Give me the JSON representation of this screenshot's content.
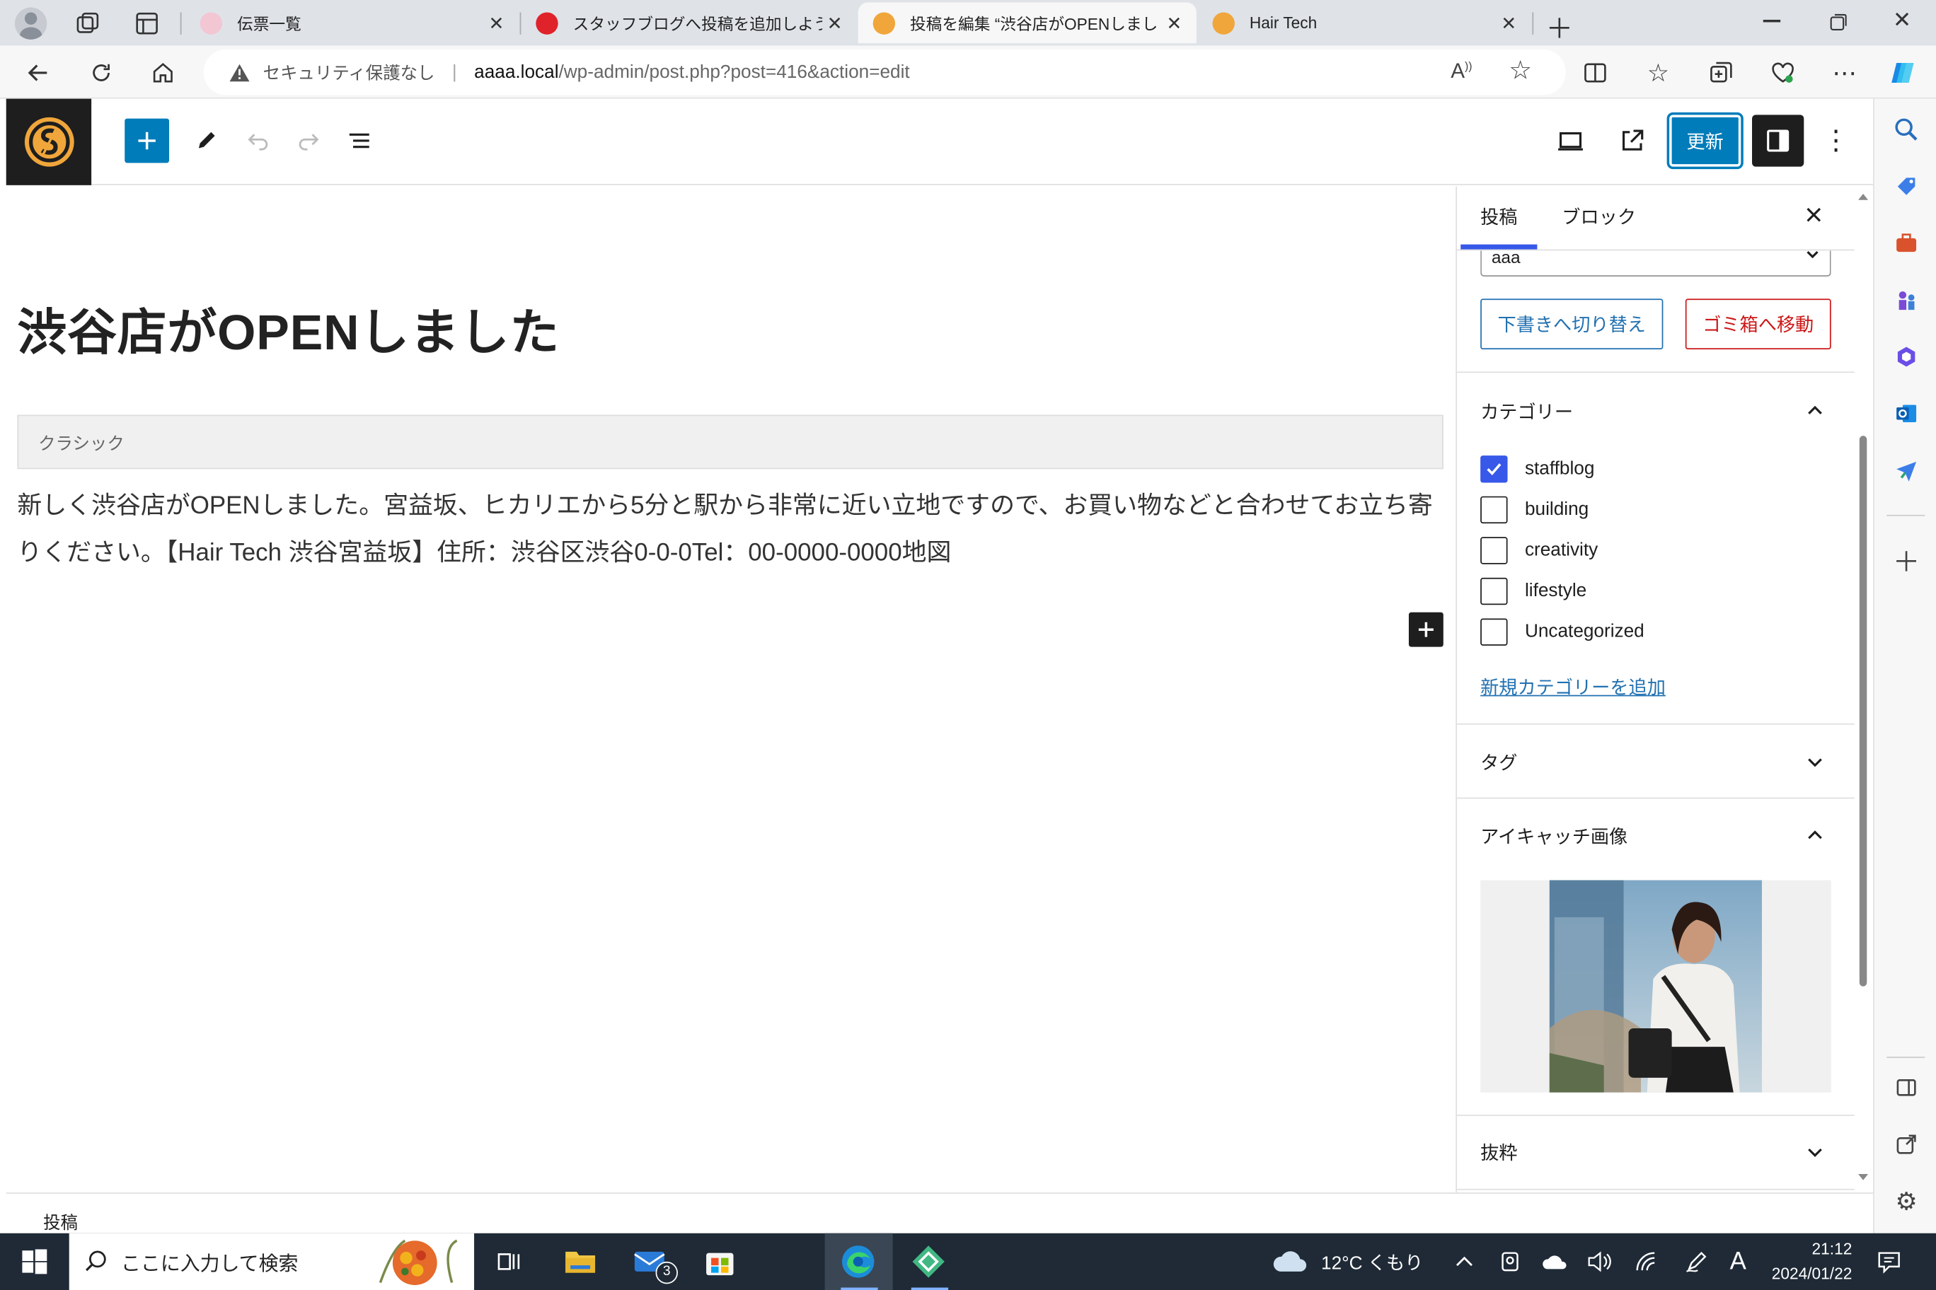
{
  "browser": {
    "tabs": [
      {
        "title": "伝票一覧",
        "active": false,
        "favicon_color": "#e8a0b8"
      },
      {
        "title": "スタッフブログへ投稿を追加しよう | ブ",
        "active": false,
        "favicon_color": "#e0222b"
      },
      {
        "title": "投稿を編集 “渋谷店がOPENしまし",
        "active": true,
        "favicon_color": "#f0a63a"
      },
      {
        "title": "Hair Tech",
        "active": false,
        "favicon_color": "#f0a63a"
      }
    ],
    "security_label": "セキュリティ保護なし",
    "url_host": "aaaa.local",
    "url_path": "/wp-admin/post.php?post=416&action=edit"
  },
  "toolbar": {
    "update_label": "更新"
  },
  "editor": {
    "post_title": "渋谷店がOPENしました",
    "classic_block_label": "クラシック",
    "body_text": "新しく渋谷店がOPENしました。宮益坂、ヒカリエから5分と駅から非常に近い立地ですので、お買い物などと合わせてお立ち寄りください。【Hair Tech 渋谷宮益坂】住所：渋谷区渋谷0-0-0Tel：00-0000-0000地図"
  },
  "sidebar": {
    "tab_post": "投稿",
    "tab_block": "ブロック",
    "select_value": "aaa",
    "switch_draft_label": "下書きへ切り替え",
    "trash_label": "ゴミ箱へ移動",
    "categories_title": "カテゴリー",
    "categories": [
      {
        "label": "staffblog",
        "checked": true
      },
      {
        "label": "building",
        "checked": false
      },
      {
        "label": "creativity",
        "checked": false
      },
      {
        "label": "lifestyle",
        "checked": false
      },
      {
        "label": "Uncategorized",
        "checked": false
      }
    ],
    "add_category_label": "新規カテゴリーを追加",
    "tags_title": "タグ",
    "featured_image_title": "アイキャッチ画像",
    "excerpt_title": "抜粋"
  },
  "status_bar": {
    "breadcrumb": "投稿"
  },
  "taskbar": {
    "search_placeholder": "ここに入力して検索",
    "weather": "12°C くもり",
    "mail_badge": "3",
    "time": "21:12",
    "date": "2024/01/22",
    "ime": "A"
  },
  "colors": {
    "wp_blue": "#3858e9",
    "update_blue": "#007cba",
    "trash_red": "#cc1818",
    "taskbar_bg": "#1f2a36"
  }
}
